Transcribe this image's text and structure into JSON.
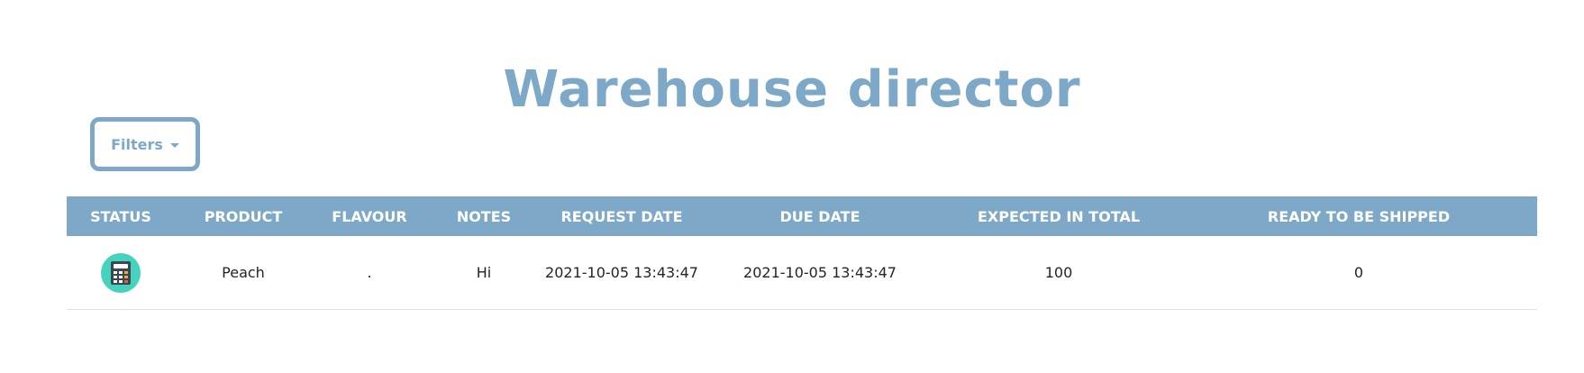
{
  "page": {
    "title": "Warehouse director"
  },
  "toolbar": {
    "filters_label": "Filters"
  },
  "table": {
    "columns": [
      "STATUS",
      "PRODUCT",
      "FLAVOUR",
      "NOTES",
      "REQUEST DATE",
      "DUE DATE",
      "EXPECTED IN TOTAL",
      "READY TO BE SHIPPED"
    ],
    "rows": [
      {
        "status_icon": "calculator-icon",
        "product": "Peach",
        "flavour": ".",
        "notes": "Hi",
        "request_date": "2021-10-05 13:43:47",
        "due_date": "2021-10-05 13:43:47",
        "expected_in_total": "100",
        "ready_to_be_shipped": "0"
      }
    ]
  },
  "colors": {
    "accent": "#7da8c7",
    "status_badge": "#46d3bd",
    "header_text": "#ffffff"
  }
}
